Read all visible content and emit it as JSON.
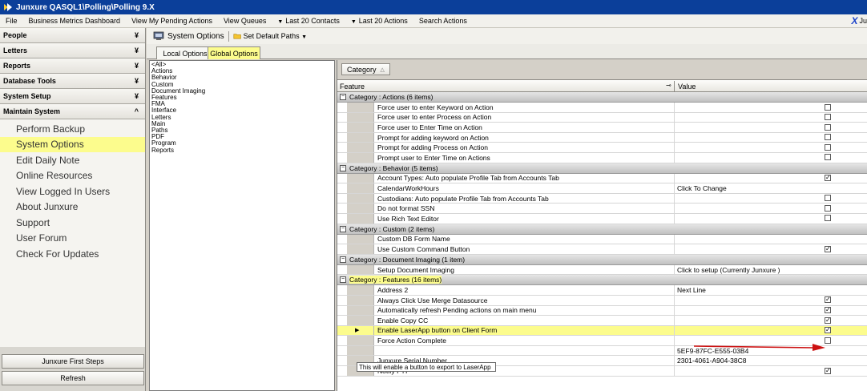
{
  "window": {
    "title": "Junxure QASQL1\\Polling\\Polling  9.X"
  },
  "menu": {
    "items": [
      "File",
      "Business Metrics Dashboard",
      "View My Pending Actions",
      "View Queues"
    ],
    "dropdowns": [
      "Last 20 Contacts",
      "Last 20 Actions"
    ],
    "search": "Search Actions",
    "brand": "Ju"
  },
  "sidebar": {
    "sections": [
      "People",
      "Letters",
      "Reports",
      "Database Tools",
      "System Setup",
      "Maintain System"
    ],
    "items": [
      "Perform Backup",
      "System Options",
      "Edit Daily Note",
      "Online Resources",
      "View Logged In Users",
      "About Junxure",
      "Support",
      "User Forum",
      "Check For Updates"
    ],
    "first_steps": "Junxure First Steps",
    "refresh": "Refresh"
  },
  "toolbar": {
    "title": "System Options",
    "default_paths": "Set Default Paths"
  },
  "tabs": {
    "local": "Local Options",
    "global": "Global Options"
  },
  "categories": [
    "<All>",
    "Actions",
    "Behavior",
    "Custom",
    "Document Imaging",
    "Features",
    "FMA",
    "Interface",
    "Letters",
    "Main",
    "Paths",
    "PDF",
    "Program",
    "Reports"
  ],
  "grid": {
    "group_by": "Category",
    "col_feature": "Feature",
    "col_value": "Value",
    "groups": [
      {
        "label": "Category : Actions (6 items)",
        "rows": [
          {
            "feature": "Force user to enter Keyword on Action",
            "value": "",
            "checked": false
          },
          {
            "feature": "Force user to enter Process on Action",
            "value": "",
            "checked": false
          },
          {
            "feature": "Force user to Enter Time on Action",
            "value": "",
            "checked": false
          },
          {
            "feature": "Prompt for adding keyword on Action",
            "value": "",
            "checked": false
          },
          {
            "feature": "Prompt for adding Process on Action",
            "value": "",
            "checked": false
          },
          {
            "feature": "Prompt user to Enter Time on Actions",
            "value": "",
            "checked": false
          }
        ]
      },
      {
        "label": "Category : Behavior (5 items)",
        "rows": [
          {
            "feature": "Account Types: Auto populate Profile Tab from Accounts Tab",
            "value": "",
            "checked": true
          },
          {
            "feature": "CalendarWorkHours",
            "value": "Click To Change"
          },
          {
            "feature": "Custodians: Auto populate Profile Tab from Accounts Tab",
            "value": "",
            "checked": false
          },
          {
            "feature": "Do not format SSN",
            "value": "",
            "checked": false
          },
          {
            "feature": "Use Rich Text Editor",
            "value": "",
            "checked": false
          }
        ]
      },
      {
        "label": "Category : Custom (2 items)",
        "rows": [
          {
            "feature": "Custom DB Form Name",
            "value": ""
          },
          {
            "feature": "Use Custom Command Button",
            "value": "",
            "checked": true
          }
        ]
      },
      {
        "label": "Category : Document Imaging (1 item)",
        "rows": [
          {
            "feature": "Setup Document Imaging",
            "value": "Click to setup (Currently Junxure )"
          }
        ]
      },
      {
        "label": "Category : Features (16 items)",
        "rows": [
          {
            "feature": "Address 2",
            "value": "Next Line"
          },
          {
            "feature": "Always Click Use Merge Datasource",
            "value": "",
            "checked": true
          },
          {
            "feature": "Automatically refresh Pending actions on main menu",
            "value": "",
            "checked": true
          },
          {
            "feature": "Enable Copy CC",
            "value": "",
            "checked": true
          },
          {
            "feature": "Enable LaserApp button on Client Form",
            "value": "",
            "checked": true,
            "selected": true
          },
          {
            "feature": "Force Action Complete",
            "value": "",
            "checked": false
          },
          {
            "feature": "",
            "value": "5EF9-87FC-E555-03B4"
          },
          {
            "feature": "Junxure Serial Number",
            "value": "2301-4061-A904-38C8"
          },
          {
            "feature": "Notify FYI",
            "value": "",
            "checked": true
          }
        ]
      }
    ]
  },
  "tooltip": "This will enable a button to export to LaserApp",
  "colors": {
    "title_bar": "#0b3f9a",
    "highlight": "#fcfc8d",
    "arrow": "#cc1111"
  }
}
